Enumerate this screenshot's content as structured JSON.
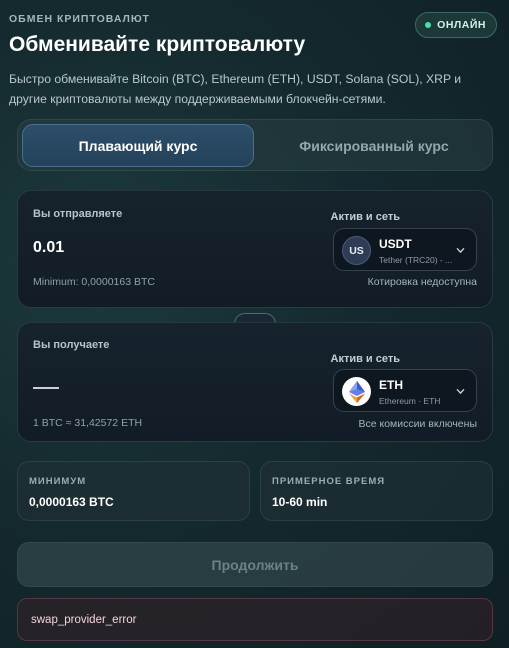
{
  "header": {
    "eyebrow": "ОБМЕН КРИПТОВАЛЮТ",
    "status_badge": "ОНЛАЙН",
    "title": "Обменивайте криптовалюту",
    "subtitle": "Быстро обменивайте Bitcoin (BTC), Ethereum (ETH), USDT, Solana (SOL), XRP и другие криптовалюты между поддерживаемыми блокчейн-сетями."
  },
  "rate_mode": {
    "tabs": [
      {
        "label": "Плавающий курс",
        "active": true
      },
      {
        "label": "Фиксированный курс",
        "active": false
      }
    ]
  },
  "send": {
    "label": "Вы отправляете",
    "amount": "0.01",
    "minimum_note": "Minimum: 0,0000163 BTC",
    "asset_label": "Актив и сеть",
    "asset": {
      "icon_text": "US",
      "code": "USDT",
      "network": "Tether (TRC20) - ..."
    },
    "asset_status": "Котировка недоступна"
  },
  "swap_icon": "swap-arrows-icon",
  "receive": {
    "label": "Вы получаете",
    "amount": "—",
    "rate_note": "1 BTC ≈ 31,42572 ETH",
    "asset_label": "Актив и сеть",
    "asset": {
      "icon": "ethereum-icon",
      "code": "ETH",
      "network": "Ethereum · ETH"
    },
    "fees_note": "Все комиссии включены"
  },
  "info": {
    "minimum": {
      "label": "МИНИМУМ",
      "value": "0,0000163 BTC"
    },
    "estimated_time": {
      "label": "ПРИМЕРНОЕ ВРЕМЯ",
      "value": "10-60 min"
    }
  },
  "continue_label": "Продолжить",
  "error_message": "swap_provider_error",
  "colors": {
    "online": "#45e0b0",
    "accent": "#2d4e69"
  }
}
